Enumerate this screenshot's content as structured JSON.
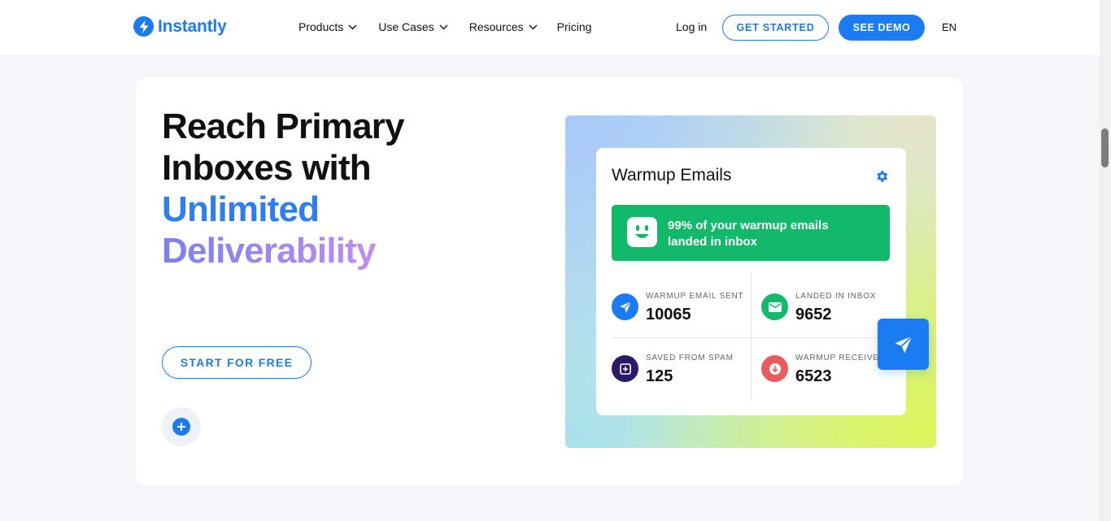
{
  "header": {
    "logo_text": "Instantly",
    "nav": [
      {
        "label": "Products"
      },
      {
        "label": "Use Cases"
      },
      {
        "label": "Resources"
      },
      {
        "label": "Pricing"
      }
    ],
    "login": "Log in",
    "get_started": "GET STARTED",
    "see_demo": "SEE DEMO",
    "lang": "EN"
  },
  "hero": {
    "line1": "Reach Primary",
    "line2": "Inboxes with",
    "line3": "Unlimited",
    "line4": "Deliverability",
    "cta": "START FOR FREE"
  },
  "widget": {
    "title": "Warmup Emails",
    "banner_line1": "99% of your warmup emails",
    "banner_line2": "landed in inbox",
    "stats": [
      {
        "label": "WARMUP EMAIL SENT",
        "value": "10065",
        "icon": "send-icon",
        "color": "#1b7bf2"
      },
      {
        "label": "LANDED IN INBOX",
        "value": "9652",
        "icon": "mail-icon",
        "color": "#12b96a"
      },
      {
        "label": "SAVED FROM SPAM",
        "value": "125",
        "icon": "spam-icon",
        "color": "#2b1a66"
      },
      {
        "label": "WARMUP RECEIVED",
        "value": "6523",
        "icon": "download-icon",
        "color": "#ec5b5b"
      }
    ]
  },
  "colors": {
    "brand": "#1b7bf2",
    "success": "#12b96a"
  }
}
